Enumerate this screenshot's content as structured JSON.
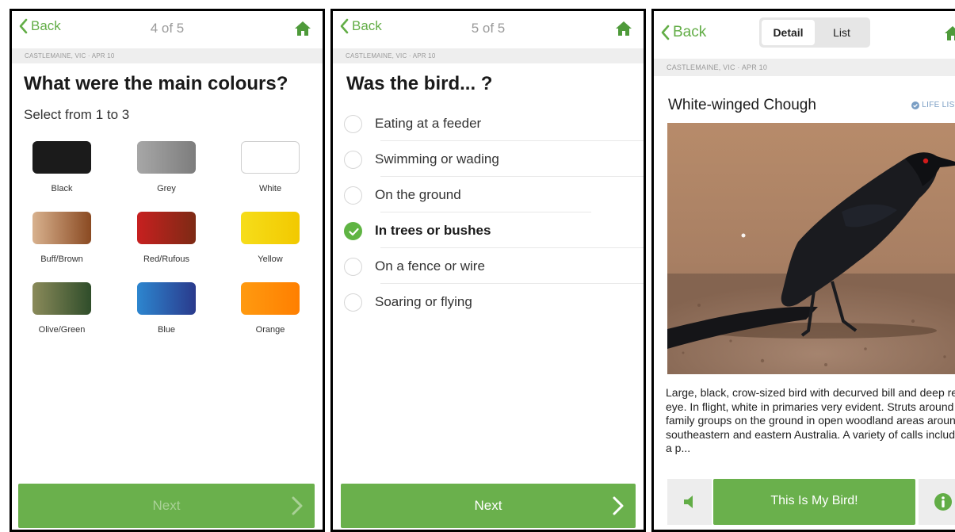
{
  "colors": {
    "accent": "#6ab04c",
    "accent_dark": "#5fb443",
    "muted_text": "#9a9a9a",
    "life_list": "#7a9ec4"
  },
  "screen1": {
    "back_label": "Back",
    "step": "4 of 5",
    "location": "CASTLEMAINE, VIC · APR 10",
    "title": "What were the main colours?",
    "subtitle": "Select from 1 to 3",
    "swatches": [
      {
        "label": "Black",
        "icon": "color-swatch-black"
      },
      {
        "label": "Grey",
        "icon": "color-swatch-grey"
      },
      {
        "label": "White",
        "icon": "color-swatch-white"
      },
      {
        "label": "Buff/Brown",
        "icon": "color-swatch-buff-brown"
      },
      {
        "label": "Red/Rufous",
        "icon": "color-swatch-red-rufous"
      },
      {
        "label": "Yellow",
        "icon": "color-swatch-yellow"
      },
      {
        "label": "Olive/Green",
        "icon": "color-swatch-olive-green"
      },
      {
        "label": "Blue",
        "icon": "color-swatch-blue"
      },
      {
        "label": "Orange",
        "icon": "color-swatch-orange"
      }
    ],
    "next_label": "Next",
    "next_enabled": false
  },
  "screen2": {
    "back_label": "Back",
    "step": "5 of 5",
    "location": "CASTLEMAINE, VIC · APR 10",
    "title": "Was the bird... ?",
    "options": [
      {
        "label": "Eating at a feeder",
        "selected": false
      },
      {
        "label": "Swimming or wading",
        "selected": false
      },
      {
        "label": "On the ground",
        "selected": false
      },
      {
        "label": "In trees or bushes",
        "selected": true
      },
      {
        "label": "On a fence or wire",
        "selected": false
      },
      {
        "label": "Soaring or flying",
        "selected": false
      }
    ],
    "next_label": "Next",
    "next_enabled": true
  },
  "screen3": {
    "back_label": "Back",
    "tabs": [
      {
        "label": "Detail",
        "active": true
      },
      {
        "label": "List",
        "active": false
      }
    ],
    "location": "CASTLEMAINE, VIC · APR 10",
    "bird_name": "White-winged Chough",
    "life_list_label": "LIFE LIST",
    "description": "Large, black, crow-sized bird with decurved bill and deep red eye. In flight, white in primaries very evident. Struts around in family groups on the ground in open woodland areas around southeastern and eastern Australia. A variety of calls includes a p...",
    "primary_button": "This Is My Bird!",
    "icons": {
      "back": "chevron-left-icon",
      "home": "home-icon",
      "next": "chevron-right-icon",
      "sound": "speaker-icon",
      "info": "info-icon",
      "life_list": "check-circle-icon"
    }
  }
}
